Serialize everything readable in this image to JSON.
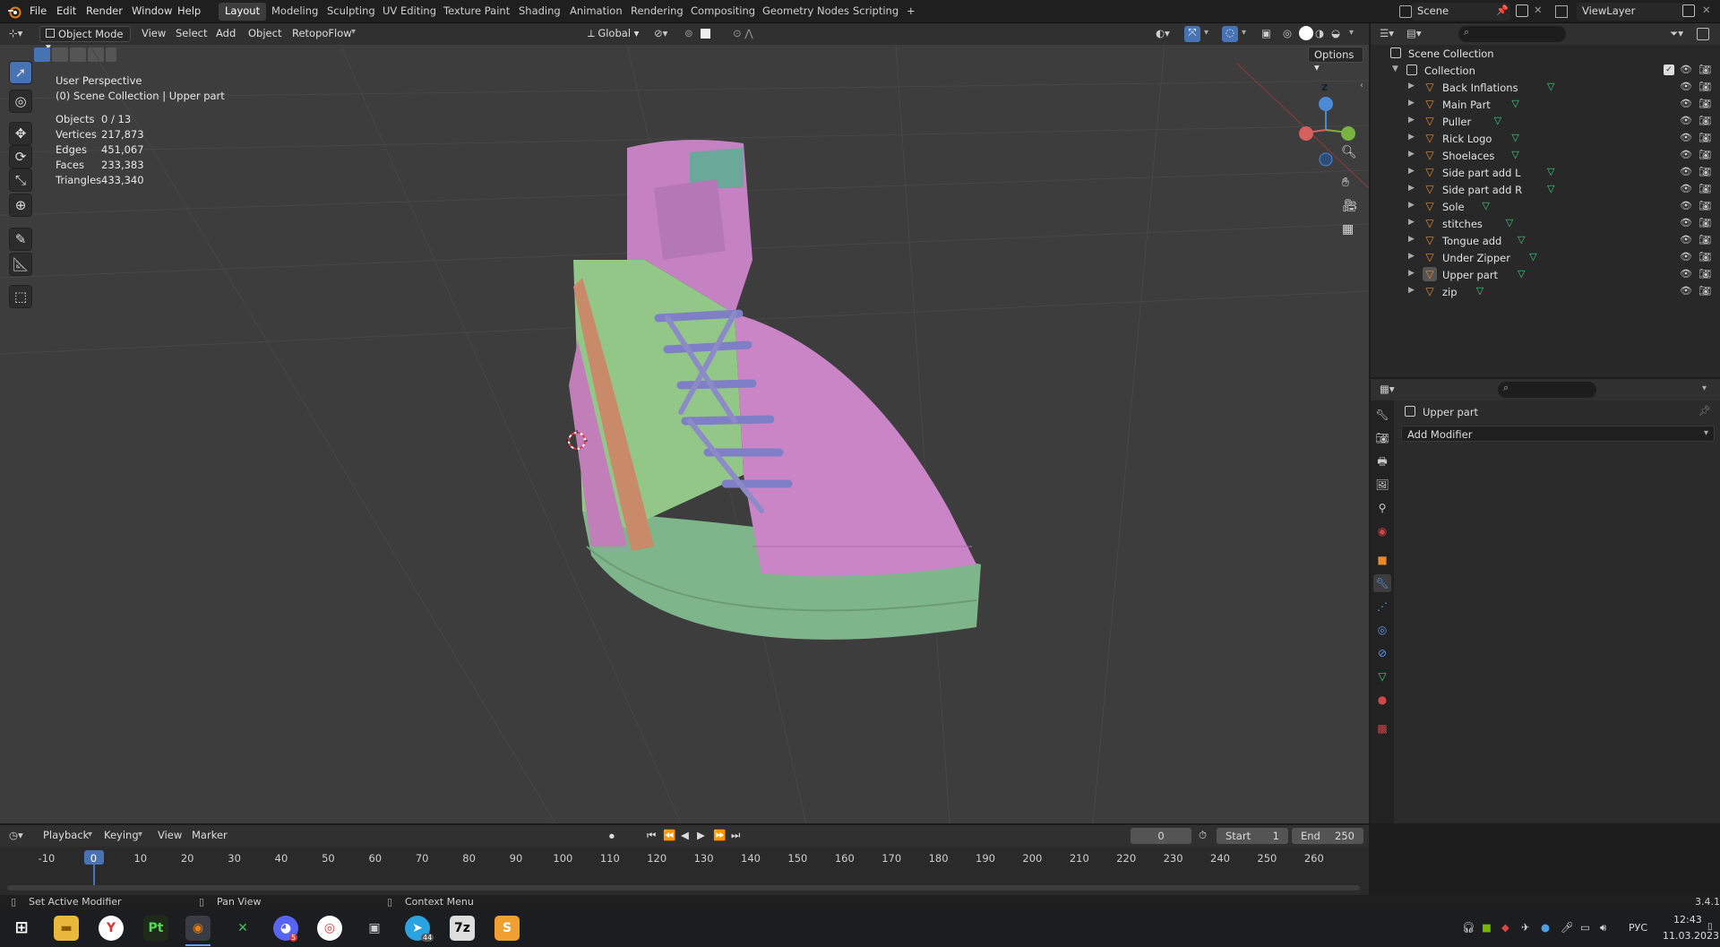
{
  "topbar": {
    "menus": [
      "File",
      "Edit",
      "Render",
      "Window",
      "Help"
    ],
    "workspaces": [
      "Layout",
      "Modeling",
      "Sculpting",
      "UV Editing",
      "Texture Paint",
      "Shading",
      "Animation",
      "Rendering",
      "Compositing",
      "Geometry Nodes",
      "Scripting",
      "+"
    ],
    "active_workspace": "Layout",
    "scene": "Scene",
    "view_layer": "ViewLayer"
  },
  "viewport": {
    "mode": "Object Mode",
    "menus": [
      "View",
      "Select",
      "Add",
      "Object",
      "RetopoFlow"
    ],
    "transform_orientation": "Global",
    "options_label": "Options",
    "perspective_label": "User Perspective",
    "context_label": "(0) Scene Collection | Upper part",
    "stats": [
      {
        "label": "Objects",
        "value": "0 / 13"
      },
      {
        "label": "Vertices",
        "value": "217,873"
      },
      {
        "label": "Edges",
        "value": "451,067"
      },
      {
        "label": "Faces",
        "value": "233,383"
      },
      {
        "label": "Triangles",
        "value": "433,340"
      }
    ],
    "gizmo_axis": "Z"
  },
  "outliner": {
    "root": "Scene Collection",
    "collection": "Collection",
    "items": [
      "Back Inflations",
      "Main Part",
      "Puller",
      "Rick Logo",
      "Shoelaces",
      "Side part add L",
      "Side part add R",
      "Sole",
      "stitches",
      "Tongue add",
      "Under Zipper",
      "Upper part",
      "zip"
    ]
  },
  "properties": {
    "object_name": "Upper part",
    "add_modifier_label": "Add Modifier"
  },
  "timeline": {
    "menus": [
      "Playback",
      "Keying",
      "View",
      "Marker"
    ],
    "current_frame": "0",
    "start_label": "Start",
    "start_value": "1",
    "end_label": "End",
    "end_value": "250",
    "ticks": [
      "-10",
      "0",
      "10",
      "20",
      "30",
      "40",
      "50",
      "60",
      "70",
      "80",
      "90",
      "100",
      "110",
      "120",
      "130",
      "140",
      "150",
      "160",
      "170",
      "180",
      "190",
      "200",
      "210",
      "220",
      "230",
      "240",
      "250",
      "260"
    ]
  },
  "status": {
    "left": "Set Active Modifier",
    "middle": "Pan View",
    "right": "Context Menu",
    "version": "3.4.1"
  },
  "taskbar": {
    "lang": "РУС",
    "time": "12:43",
    "date": "11.03.2023",
    "telegram_badge": "44",
    "discord_badge": "5"
  },
  "colors": {
    "accent": "#4772b3",
    "viewport_bg": "#3d3d3d",
    "mesh_pink": "#c97fc4",
    "mesh_green": "#8fc48a",
    "laces": "#8079c4"
  }
}
